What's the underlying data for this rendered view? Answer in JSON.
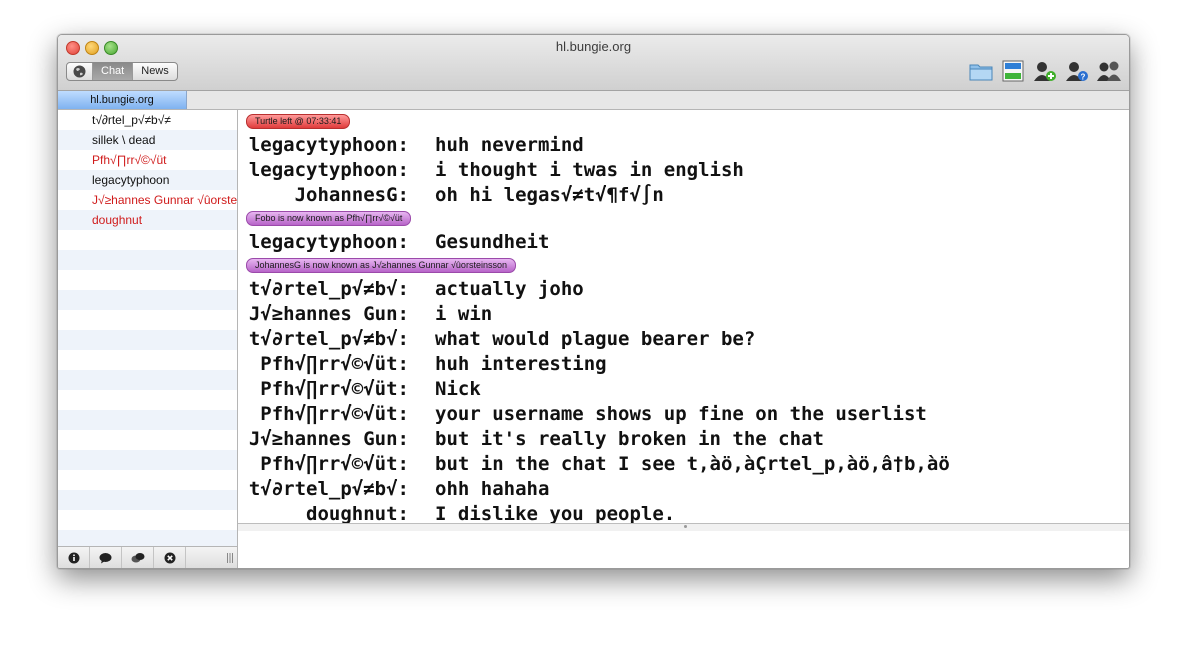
{
  "window": {
    "title": "hl.bungie.org"
  },
  "toolbar": {
    "segments": [
      {
        "icon": "globe-icon"
      },
      {
        "label": "Chat"
      },
      {
        "label": "News"
      }
    ],
    "icons": [
      "folder-icon",
      "window-layout-icon",
      "add-user-icon",
      "user-info-icon",
      "users-icon"
    ]
  },
  "tabs": [
    {
      "label": "hl.bungie.org"
    }
  ],
  "users": [
    {
      "name": "t√∂rtel_p√≠b√≠",
      "color": "#111111"
    },
    {
      "name": " sillek \\ dead",
      "color": "#111111"
    },
    {
      "name": "Pfh√∏rr√©√üt",
      "color": "#d01b1b"
    },
    {
      "name": "legacytyphoon",
      "color": "#111111"
    },
    {
      "name": "J√≥hannes Gunnar √ûorsteinsson",
      "color": "#d01b1b"
    },
    {
      "name": "doughnut",
      "color": "#d01b1b"
    }
  ],
  "sidebar_buttons": [
    "info-icon",
    "speech-bubble-icon",
    "speech-bubbles-icon",
    "close-circle-icon"
  ],
  "chat": [
    {
      "type": "event",
      "text": "Turtle left @ 07:33:41",
      "color": "red"
    },
    {
      "type": "msg",
      "nick": "legacytyphoon:",
      "text": "huh nevermind"
    },
    {
      "type": "msg",
      "nick": "legacytyphoon:",
      "text": "i thought i twas in english"
    },
    {
      "type": "msg",
      "nick": "JohannesG:",
      "text": "oh hi legas√≠t√¶f√∫n"
    },
    {
      "type": "event",
      "text": "Fobo is now known as Pfh√∏rr√©√üt",
      "color": "purple"
    },
    {
      "type": "msg",
      "nick": "legacytyphoon:",
      "text": "Gesundheit"
    },
    {
      "type": "event",
      "text": "JohannesG is now known as J√≥hannes Gunnar √ûorsteinsson",
      "color": "purple"
    },
    {
      "type": "msg",
      "nick": "t√∂rtel_p√≠b√:",
      "text": "actually joho"
    },
    {
      "type": "msg",
      "nick": "J√≥hannes Gun:",
      "text": "i win"
    },
    {
      "type": "msg",
      "nick": "t√∂rtel_p√≠b√:",
      "text": "what would plague bearer be?"
    },
    {
      "type": "msg",
      "nick": "Pfh√∏rr√©√üt:",
      "text": "huh interesting"
    },
    {
      "type": "msg",
      "nick": "Pfh√∏rr√©√üt:",
      "text": "Nick"
    },
    {
      "type": "msg",
      "nick": "Pfh√∏rr√©√üt:",
      "text": "your username shows up fine on the userlist"
    },
    {
      "type": "msg",
      "nick": "J√≥hannes Gun:",
      "text": "but it's really broken in the chat"
    },
    {
      "type": "msg",
      "nick": "Pfh√∏rr√©√üt:",
      "text": "but in the chat I see t,àö,àÇrtel_p,àö,â†b,àö"
    },
    {
      "type": "msg",
      "nick": "t√∂rtel_p√≠b√:",
      "text": "ohh hahaha"
    },
    {
      "type": "msg",
      "nick": "doughnut:",
      "text": "I dislike you people."
    }
  ],
  "input": {
    "value": ""
  }
}
